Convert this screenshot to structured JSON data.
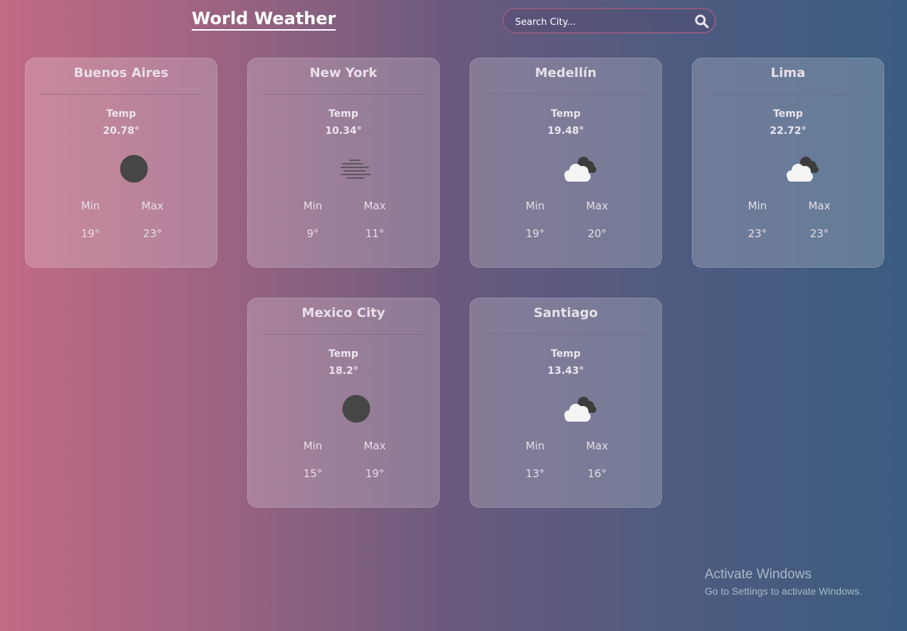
{
  "header": {
    "title": "World Weather"
  },
  "search": {
    "placeholder": "Search City...",
    "icon": "search-icon"
  },
  "cards": [
    {
      "city": "Buenos Aires",
      "temp_label": "Temp",
      "temp": "20.78°",
      "icon": "clear-icon",
      "min_label": "Min",
      "max_label": "Max",
      "min": "19°",
      "max": "23°"
    },
    {
      "city": "New York",
      "temp_label": "Temp",
      "temp": "10.34°",
      "icon": "mist-icon",
      "min_label": "Min",
      "max_label": "Max",
      "min": "9°",
      "max": "11°"
    },
    {
      "city": "Medellín",
      "temp_label": "Temp",
      "temp": "19.48°",
      "icon": "clouds-icon",
      "min_label": "Min",
      "max_label": "Max",
      "min": "19°",
      "max": "20°"
    },
    {
      "city": "Lima",
      "temp_label": "Temp",
      "temp": "22.72°",
      "icon": "clouds-icon",
      "min_label": "Min",
      "max_label": "Max",
      "min": "23°",
      "max": "23°"
    },
    {
      "city": "Mexico City",
      "temp_label": "Temp",
      "temp": "18.2°",
      "icon": "clear-icon",
      "min_label": "Min",
      "max_label": "Max",
      "min": "15°",
      "max": "19°"
    },
    {
      "city": "Santiago",
      "temp_label": "Temp",
      "temp": "13.43°",
      "icon": "clouds-icon",
      "min_label": "Min",
      "max_label": "Max",
      "min": "13°",
      "max": "16°"
    }
  ],
  "watermark": {
    "line1": "Activate Windows",
    "line2": "Go to Settings to activate Windows."
  }
}
